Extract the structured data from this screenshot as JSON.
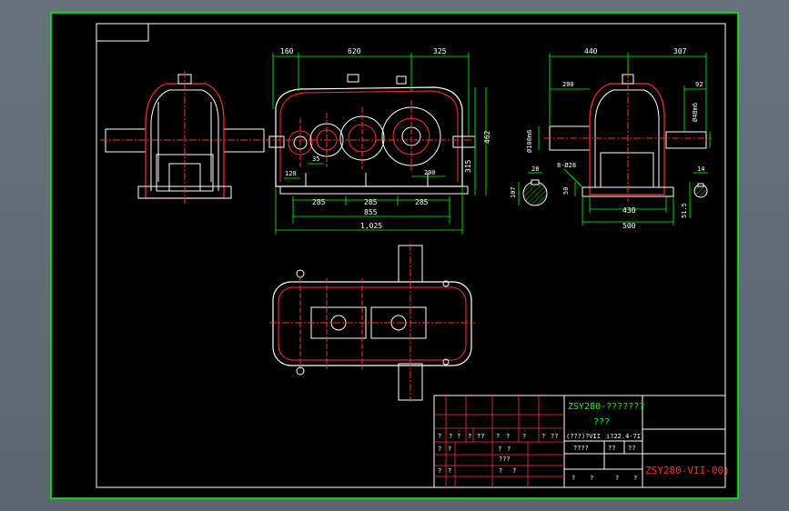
{
  "colors": {
    "background": "#000000",
    "outer_border": "#00ff00",
    "frame": "#ffffff",
    "dimension": "#00ff00",
    "part_outline": "#ffffff",
    "part_fill": "#ff3030",
    "center_line": "#ff3030",
    "title_grid": "#ff3030"
  },
  "front_view": {
    "top_dims": [
      "160",
      "620",
      "325"
    ],
    "bottom_dims": [
      "285",
      "285",
      "285"
    ],
    "overall_dims": [
      "855",
      "1,025"
    ],
    "side_dims": [
      "315",
      "462"
    ],
    "inner_dims": [
      "120",
      "35",
      "200"
    ]
  },
  "side_view": {
    "top_dims": [
      "440",
      "307"
    ],
    "inner_dims": [
      "200",
      "92"
    ],
    "side_labels": [
      "Ø100m6",
      "Ø48m6"
    ],
    "bottom_dims": [
      "430",
      "500"
    ],
    "foot_label": "8-Ø28",
    "foot_dim": "50",
    "keyway_dims": [
      "28",
      "107",
      "14",
      "51.5"
    ]
  },
  "title_block": {
    "title_line1": "ZSY280-???????",
    "title_line2": "???",
    "spec_left": "(???)?VII",
    "spec_right": "i?22.4-7I)",
    "mid_labels": [
      "????",
      "??",
      "??"
    ],
    "drawing_no": "ZSY280-VII-00)",
    "grid_row1": [
      "?",
      "?",
      "?",
      "?",
      "??",
      "?",
      "?",
      "?",
      "?",
      "??"
    ],
    "grid_row2": [
      "?",
      "?",
      "?",
      "?"
    ],
    "grid_row3": [
      "???"
    ],
    "grid_row4": [
      "?",
      "?",
      "?",
      "?"
    ],
    "grid_bottom": [
      "?",
      "?",
      "?",
      "?"
    ]
  }
}
